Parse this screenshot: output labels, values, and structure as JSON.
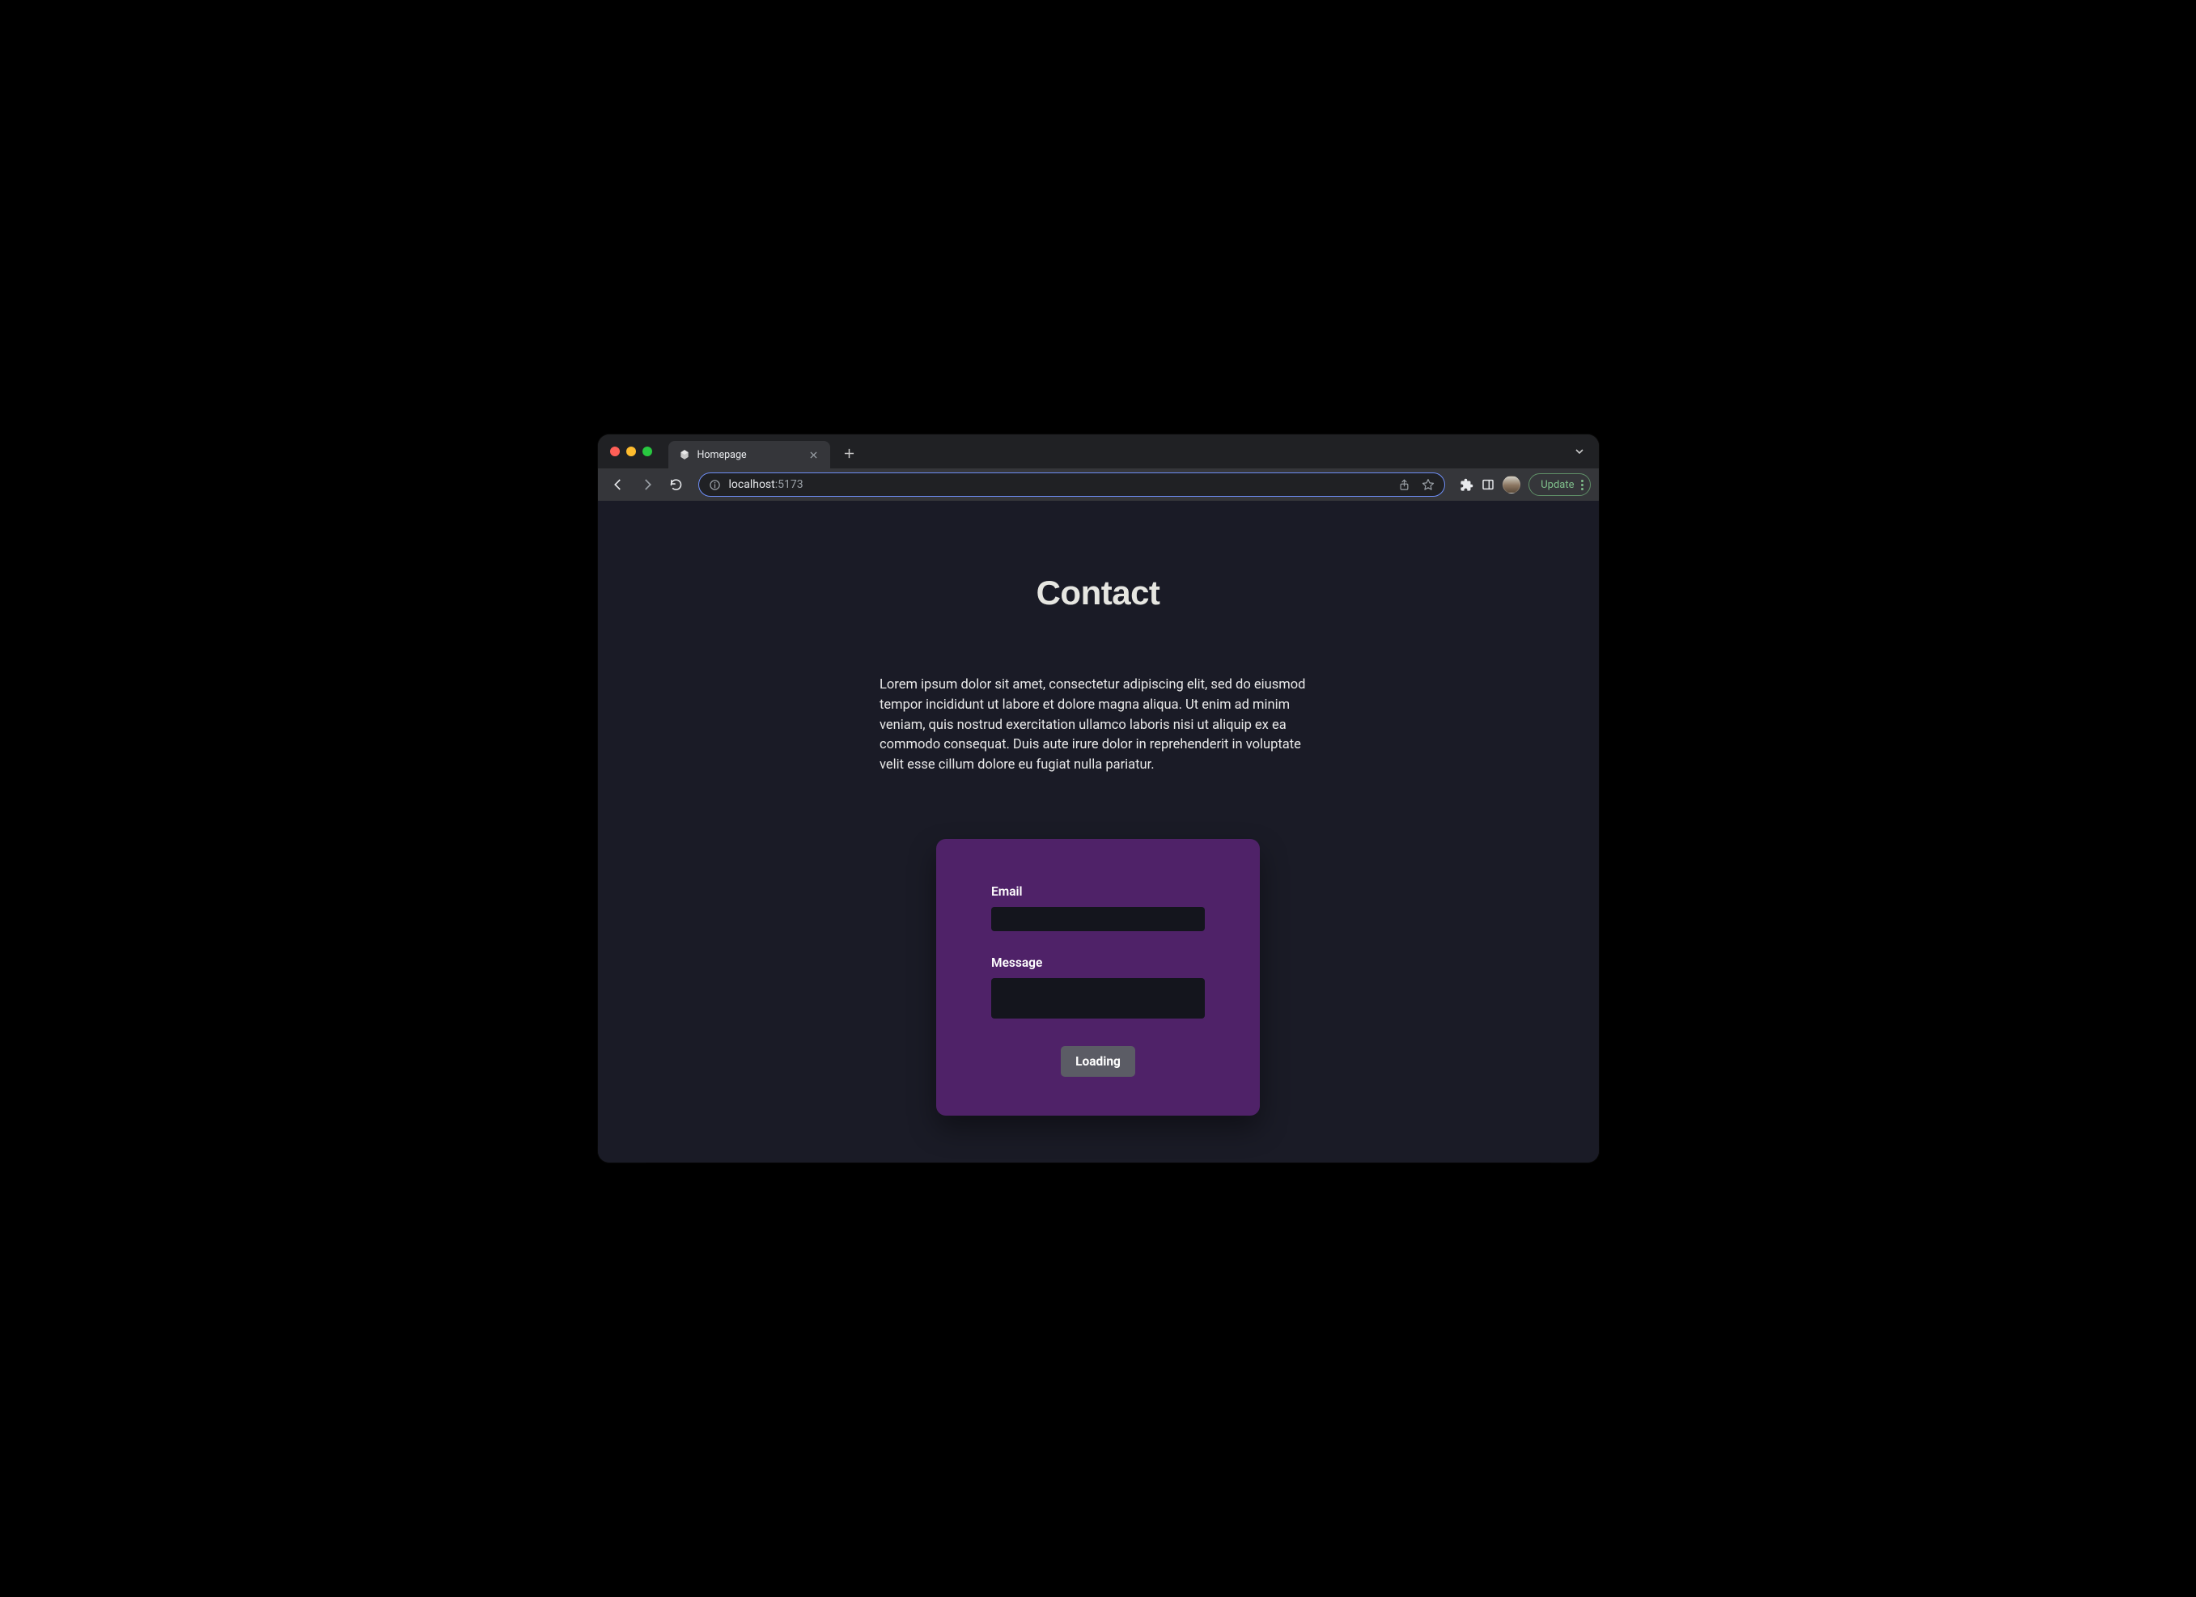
{
  "browser": {
    "tab": {
      "title": "Homepage"
    },
    "url": {
      "host": "localhost",
      "port": ":5173"
    },
    "update_label": "Update"
  },
  "page": {
    "title": "Contact",
    "intro": "Lorem ipsum dolor sit amet, consectetur adipiscing elit, sed do eiusmod tempor incididunt ut labore et dolore magna aliqua. Ut enim ad minim veniam, quis nostrud exercitation ullamco laboris nisi ut aliquip ex ea commodo consequat. Duis aute irure dolor in reprehenderit in voluptate velit esse cillum dolore eu fugiat nulla pariatur.",
    "form": {
      "email_label": "Email",
      "email_value": "",
      "message_label": "Message",
      "message_value": "",
      "submit_label": "Loading"
    }
  }
}
